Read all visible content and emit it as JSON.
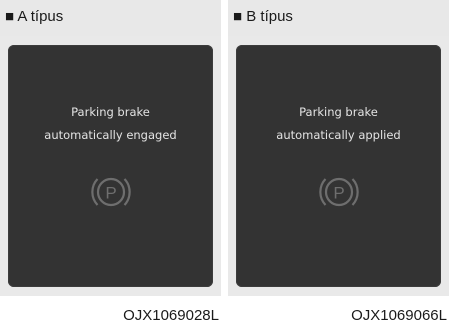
{
  "panels": [
    {
      "header": "■ A típus",
      "message_line1": "Parking brake",
      "message_line2": "automatically engaged",
      "icon": "parking-brake-icon",
      "code": "OJX1069028L"
    },
    {
      "header": "■ B típus",
      "message_line1": "Parking brake",
      "message_line2": "automatically applied",
      "icon": "parking-brake-icon",
      "code": "OJX1069066L"
    }
  ],
  "colors": {
    "panel_background": "#e9e9e9",
    "screen_background": "#333333",
    "icon": "#6e6e6e",
    "message_text": "#e3e3e3"
  }
}
